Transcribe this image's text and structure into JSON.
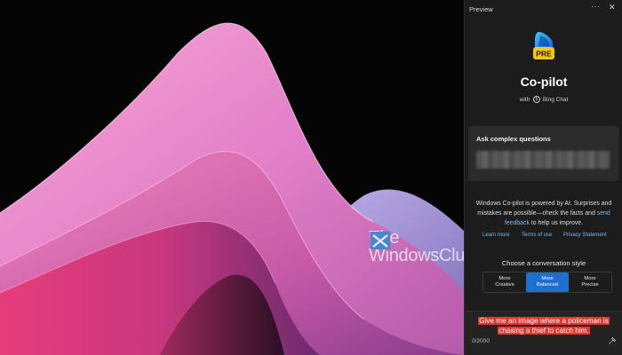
{
  "panel": {
    "title": "Preview",
    "more_glyph": "···",
    "close_glyph": "✕",
    "app_name": "Co-pilot",
    "logo_badge": "PRE",
    "with_prefix": "with",
    "with_product": "Bing Chat",
    "card": {
      "title": "Ask complex questions"
    },
    "disclaimer": {
      "text": "Windows Co-pilot is powered by AI. Surprises and mistakes are possible—check the facts and",
      "link": "send feedback",
      "suffix": "to help us improve."
    },
    "links": [
      "Learn more",
      "Terms of use",
      "Privacy Statement"
    ],
    "style_label": "Choose a conversation style",
    "styles": [
      {
        "line1": "More",
        "line2": "Creative",
        "selected": false
      },
      {
        "line1": "More",
        "line2": "Balanced",
        "selected": true
      },
      {
        "line1": "More",
        "line2": "Precise",
        "selected": false
      }
    ],
    "prompt": {
      "line1": "Give me an image where a policeman is",
      "line2": "chasing a thief to catch him."
    },
    "char_counter": "0/2000"
  },
  "watermark": {
    "line1": "The",
    "line2": "WindowsClub"
  },
  "icons": {
    "more": "more-options-icon",
    "close": "close-icon",
    "logo": "copilot-logo-icon",
    "bing": "bing-icon",
    "pin": "pin-icon",
    "watermark_logo": "windowsclub-logo-icon"
  },
  "colors": {
    "panel_bg": "#1c1c1c",
    "card_bg": "#2b2b2b",
    "link": "#7cb7f0",
    "selected_style": "#1f6fcf",
    "prompt_highlight": "#e8332f"
  }
}
